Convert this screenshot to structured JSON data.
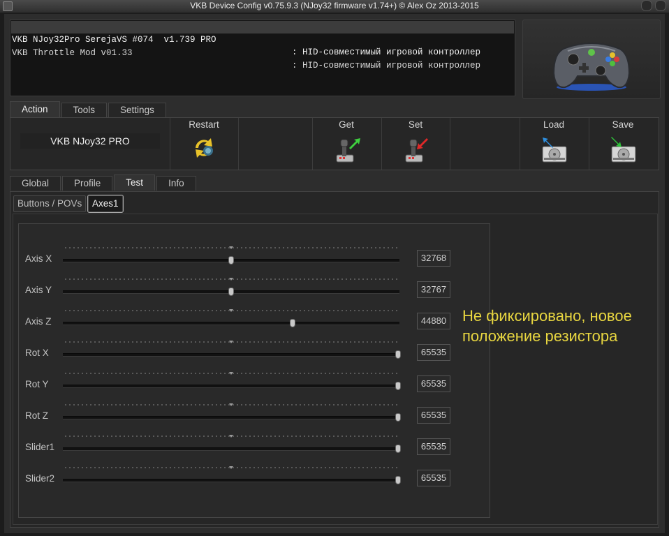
{
  "window": {
    "title": "VKB Device Config v0.75.9.3 (NJoy32 firmware v1.74+) © Alex Oz 2013-2015"
  },
  "devices": [
    {
      "name": "VKB NJoy32Pro SerejaVS #074  v1.739 PRO",
      "desc": ": HID-совместимый игровой контроллер",
      "selected": true
    },
    {
      "name": "VKB Throttle Mod v01.33",
      "desc": ": HID-совместимый игровой контроллер",
      "selected": false
    }
  ],
  "main_tabs": [
    "Action",
    "Tools",
    "Settings"
  ],
  "action": {
    "device_label": "VKB NJoy32 PRO",
    "restart": "Restart",
    "get": "Get",
    "set": "Set",
    "load": "Load",
    "save": "Save"
  },
  "sub_tabs": [
    "Global",
    "Profile",
    "Test",
    "Info"
  ],
  "test_tabs": [
    "Buttons / POVs",
    "Axes1"
  ],
  "axes": [
    {
      "label": "Axis X",
      "value": "32768",
      "level": 0.5
    },
    {
      "label": "Axis Y",
      "value": "32767",
      "level": 0.5
    },
    {
      "label": "Axis Z",
      "value": "44880",
      "level": 0.685
    },
    {
      "label": "Rot X",
      "value": "65535",
      "level": 1.0
    },
    {
      "label": "Rot Y",
      "value": "65535",
      "level": 1.0
    },
    {
      "label": "Rot Z",
      "value": "65535",
      "level": 1.0
    },
    {
      "label": "Slider1",
      "value": "65535",
      "level": 1.0
    },
    {
      "label": "Slider2",
      "value": "65535",
      "level": 1.0
    }
  ],
  "annotation": {
    "line1": "Не фиксировано, новое",
    "line2": "положение резистора"
  },
  "colors": {
    "annotation": "#e8d640"
  }
}
